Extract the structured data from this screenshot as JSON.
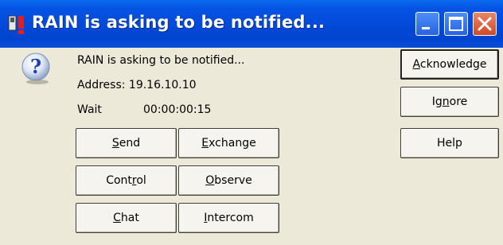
{
  "window": {
    "title": "RAIN is asking to be notified...",
    "icons": {
      "app": "app-icon",
      "question": "question-icon",
      "minimize": "minimize-icon",
      "maximize": "maximize-icon",
      "close": "close-icon"
    }
  },
  "message": {
    "text": "RAIN is asking to be notified...",
    "address": "Address: 19.16.10.10",
    "wait_label": "Wait",
    "wait_value": "00:00:00:15"
  },
  "buttons": {
    "acknowledge": {
      "pre": "",
      "key": "A",
      "post": "cknowledge"
    },
    "ignore": {
      "pre": "Ig",
      "key": "n",
      "post": "ore"
    },
    "help": {
      "pre": "Help",
      "key": "",
      "post": ""
    },
    "send": {
      "pre": "",
      "key": "S",
      "post": "end"
    },
    "exchange": {
      "pre": "",
      "key": "E",
      "post": "xchange"
    },
    "control": {
      "pre": "Cont",
      "key": "r",
      "post": "ol"
    },
    "observe": {
      "pre": "",
      "key": "O",
      "post": "bserve"
    },
    "chat": {
      "pre": "",
      "key": "C",
      "post": "hat"
    },
    "intercom": {
      "pre": "",
      "key": "I",
      "post": "ntercom"
    }
  },
  "colors": {
    "titlebar": "#0349d8",
    "close_button": "#d04a26",
    "dialog_background": "#ece9d8"
  }
}
